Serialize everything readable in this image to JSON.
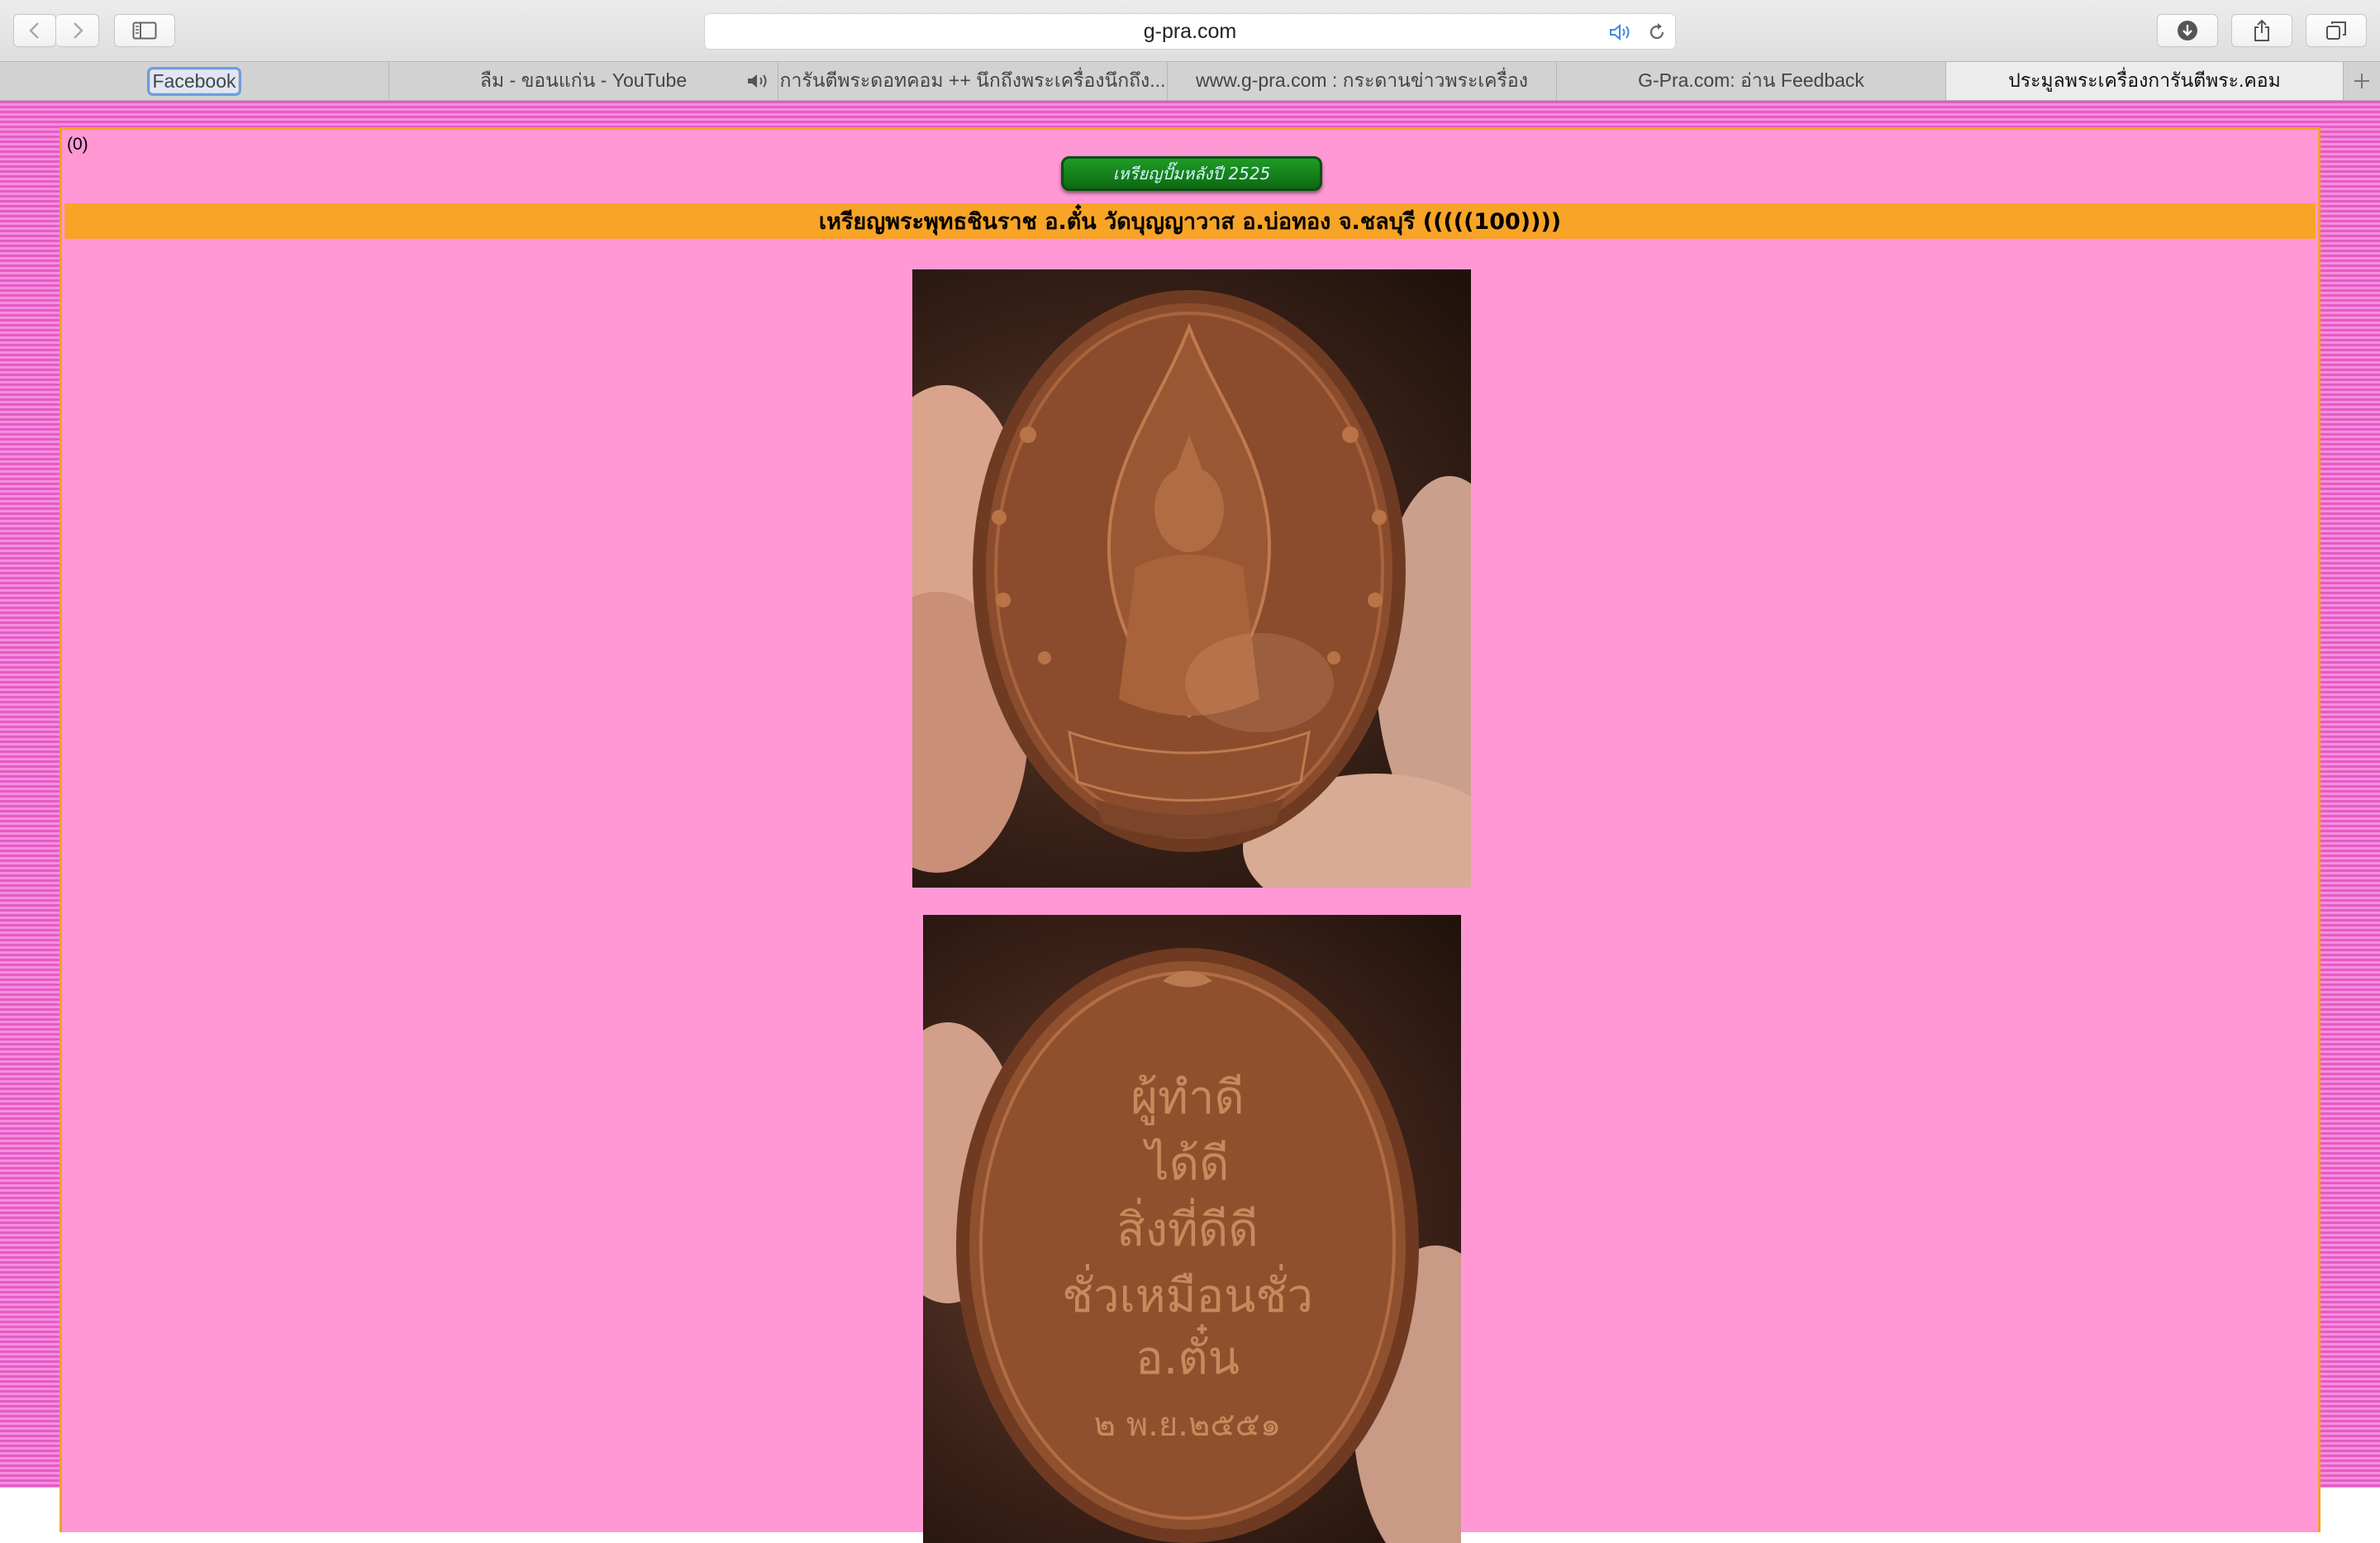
{
  "browser": {
    "url": "g-pra.com",
    "icons": {
      "back": "chevron-left-icon",
      "forward": "chevron-right-icon",
      "sidebar": "sidebar-icon",
      "audio": "speaker-icon",
      "reload": "reload-icon",
      "downloads": "download-icon",
      "share": "share-icon",
      "tabs": "tab-overview-icon",
      "new_tab": "plus-icon"
    }
  },
  "tabs": [
    {
      "label": "Facebook"
    },
    {
      "label": "ลืม - ขอนแก่น - YouTube"
    },
    {
      "label": "การันตีพระดอทคอม ++ นึกถึงพระเครื่องนึกถึง..."
    },
    {
      "label": "www.g-pra.com : กระดานข่าวพระเครื่อง"
    },
    {
      "label": "G-Pra.com: อ่าน Feedback"
    },
    {
      "label": "ประมูลพระเครื่องการันตีพระ.คอม"
    }
  ],
  "page": {
    "count": "(0)",
    "badge": "เหรียญปั๊มหลังปี 2525",
    "title": "เหรียญพระพุทธชินราช อ.ตั๋น วัดบุญญาวาส อ.บ่อทอง จ.ชลบุรี (((((100))))",
    "colors": {
      "title_bar": "#f8a426",
      "content_bg": "#ff98d5",
      "badge": "#1f9b25"
    },
    "photos": {
      "front_alt": "amulet-front-photo",
      "back_alt": "amulet-back-photo",
      "back_inscription": [
        "ผู้ทำดี",
        "ได้ดี",
        "สิ่งที่ดีดี",
        "ชั่วเหมือนชั่ว",
        "อ.ตั๋น",
        "๒ พ.ย.๒๕๕๑"
      ]
    }
  }
}
